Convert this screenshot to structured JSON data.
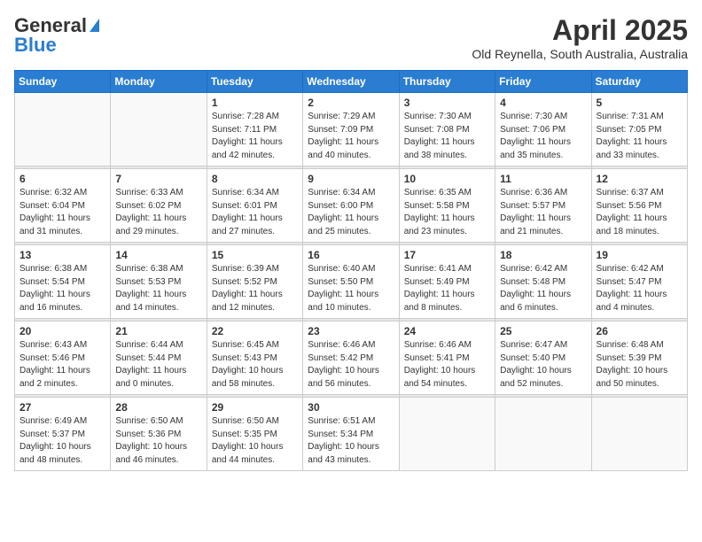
{
  "header": {
    "logo_general": "General",
    "logo_blue": "Blue",
    "month": "April 2025",
    "location": "Old Reynella, South Australia, Australia"
  },
  "calendar": {
    "days_of_week": [
      "Sunday",
      "Monday",
      "Tuesday",
      "Wednesday",
      "Thursday",
      "Friday",
      "Saturday"
    ],
    "weeks": [
      [
        {
          "day": "",
          "info": ""
        },
        {
          "day": "",
          "info": ""
        },
        {
          "day": "1",
          "info": "Sunrise: 7:28 AM\nSunset: 7:11 PM\nDaylight: 11 hours and 42 minutes."
        },
        {
          "day": "2",
          "info": "Sunrise: 7:29 AM\nSunset: 7:09 PM\nDaylight: 11 hours and 40 minutes."
        },
        {
          "day": "3",
          "info": "Sunrise: 7:30 AM\nSunset: 7:08 PM\nDaylight: 11 hours and 38 minutes."
        },
        {
          "day": "4",
          "info": "Sunrise: 7:30 AM\nSunset: 7:06 PM\nDaylight: 11 hours and 35 minutes."
        },
        {
          "day": "5",
          "info": "Sunrise: 7:31 AM\nSunset: 7:05 PM\nDaylight: 11 hours and 33 minutes."
        }
      ],
      [
        {
          "day": "6",
          "info": "Sunrise: 6:32 AM\nSunset: 6:04 PM\nDaylight: 11 hours and 31 minutes."
        },
        {
          "day": "7",
          "info": "Sunrise: 6:33 AM\nSunset: 6:02 PM\nDaylight: 11 hours and 29 minutes."
        },
        {
          "day": "8",
          "info": "Sunrise: 6:34 AM\nSunset: 6:01 PM\nDaylight: 11 hours and 27 minutes."
        },
        {
          "day": "9",
          "info": "Sunrise: 6:34 AM\nSunset: 6:00 PM\nDaylight: 11 hours and 25 minutes."
        },
        {
          "day": "10",
          "info": "Sunrise: 6:35 AM\nSunset: 5:58 PM\nDaylight: 11 hours and 23 minutes."
        },
        {
          "day": "11",
          "info": "Sunrise: 6:36 AM\nSunset: 5:57 PM\nDaylight: 11 hours and 21 minutes."
        },
        {
          "day": "12",
          "info": "Sunrise: 6:37 AM\nSunset: 5:56 PM\nDaylight: 11 hours and 18 minutes."
        }
      ],
      [
        {
          "day": "13",
          "info": "Sunrise: 6:38 AM\nSunset: 5:54 PM\nDaylight: 11 hours and 16 minutes."
        },
        {
          "day": "14",
          "info": "Sunrise: 6:38 AM\nSunset: 5:53 PM\nDaylight: 11 hours and 14 minutes."
        },
        {
          "day": "15",
          "info": "Sunrise: 6:39 AM\nSunset: 5:52 PM\nDaylight: 11 hours and 12 minutes."
        },
        {
          "day": "16",
          "info": "Sunrise: 6:40 AM\nSunset: 5:50 PM\nDaylight: 11 hours and 10 minutes."
        },
        {
          "day": "17",
          "info": "Sunrise: 6:41 AM\nSunset: 5:49 PM\nDaylight: 11 hours and 8 minutes."
        },
        {
          "day": "18",
          "info": "Sunrise: 6:42 AM\nSunset: 5:48 PM\nDaylight: 11 hours and 6 minutes."
        },
        {
          "day": "19",
          "info": "Sunrise: 6:42 AM\nSunset: 5:47 PM\nDaylight: 11 hours and 4 minutes."
        }
      ],
      [
        {
          "day": "20",
          "info": "Sunrise: 6:43 AM\nSunset: 5:46 PM\nDaylight: 11 hours and 2 minutes."
        },
        {
          "day": "21",
          "info": "Sunrise: 6:44 AM\nSunset: 5:44 PM\nDaylight: 11 hours and 0 minutes."
        },
        {
          "day": "22",
          "info": "Sunrise: 6:45 AM\nSunset: 5:43 PM\nDaylight: 10 hours and 58 minutes."
        },
        {
          "day": "23",
          "info": "Sunrise: 6:46 AM\nSunset: 5:42 PM\nDaylight: 10 hours and 56 minutes."
        },
        {
          "day": "24",
          "info": "Sunrise: 6:46 AM\nSunset: 5:41 PM\nDaylight: 10 hours and 54 minutes."
        },
        {
          "day": "25",
          "info": "Sunrise: 6:47 AM\nSunset: 5:40 PM\nDaylight: 10 hours and 52 minutes."
        },
        {
          "day": "26",
          "info": "Sunrise: 6:48 AM\nSunset: 5:39 PM\nDaylight: 10 hours and 50 minutes."
        }
      ],
      [
        {
          "day": "27",
          "info": "Sunrise: 6:49 AM\nSunset: 5:37 PM\nDaylight: 10 hours and 48 minutes."
        },
        {
          "day": "28",
          "info": "Sunrise: 6:50 AM\nSunset: 5:36 PM\nDaylight: 10 hours and 46 minutes."
        },
        {
          "day": "29",
          "info": "Sunrise: 6:50 AM\nSunset: 5:35 PM\nDaylight: 10 hours and 44 minutes."
        },
        {
          "day": "30",
          "info": "Sunrise: 6:51 AM\nSunset: 5:34 PM\nDaylight: 10 hours and 43 minutes."
        },
        {
          "day": "",
          "info": ""
        },
        {
          "day": "",
          "info": ""
        },
        {
          "day": "",
          "info": ""
        }
      ]
    ]
  }
}
